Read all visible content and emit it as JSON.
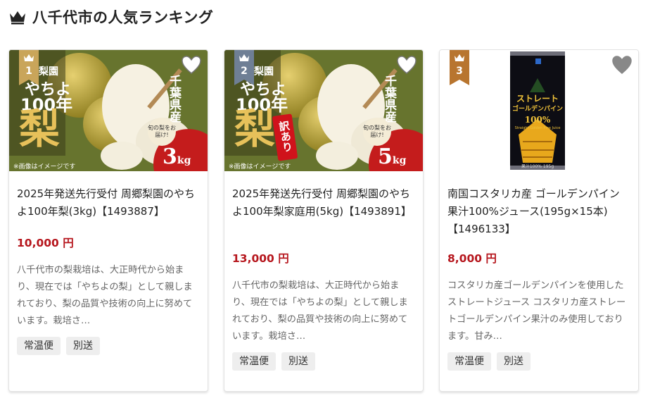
{
  "header": {
    "title": "八千代市の人気ランキング",
    "icon": "crown-icon"
  },
  "cards": [
    {
      "rank": "1",
      "rank_color": "#c9a55a",
      "name": "2025年発送先行受付 周郷梨園のやちよ100年梨(3kg)【1493887】",
      "price": "10,000 円",
      "desc": "八千代市の梨栽培は、大正時代から始まり、現在では「やちよの梨」として親しまれており、梨の品質や技術の向上に努めています。栽培さ…",
      "tags": [
        "常温便",
        "別送"
      ],
      "img": {
        "brand": "梨園",
        "yachiyo": "やちよ",
        "hundred": "100年",
        "nashi": "梨",
        "pref": "千葉県産",
        "kg": "3",
        "kg_unit": "kg",
        "note": "※画像はイメージです",
        "seal": "旬の梨をお届け!",
        "wake": ""
      }
    },
    {
      "rank": "2",
      "rank_color": "#6f7f95",
      "name": "2025年発送先行受付 周郷梨園のやちよ100年梨家庭用(5kg)【1493891】",
      "price": "13,000 円",
      "desc": "八千代市の梨栽培は、大正時代から始まり、現在では「やちよの梨」として親しまれており、梨の品質や技術の向上に努めています。栽培さ…",
      "tags": [
        "常温便",
        "別送"
      ],
      "img": {
        "brand": "梨園",
        "yachiyo": "やちよ",
        "hundred": "100年",
        "nashi": "梨",
        "pref": "千葉県産",
        "kg": "5",
        "kg_unit": "kg",
        "note": "※画像はイメージです",
        "seal": "旬の梨をお届け!",
        "wake": "訳あり"
      }
    },
    {
      "rank": "3",
      "rank_color": "#b8752f",
      "name": "南国コスタリカ産 ゴールデンパイン 果汁100%ジュース(195g×15本)【1496133】",
      "price": "8,000 円",
      "desc": "コスタリカ産ゴールデンパインを使用したストレートジュース コスタリカ産ストレートゴールデンパイン果汁のみ使用しております。甘み…",
      "tags": [
        "常温便",
        "別送"
      ],
      "img": {
        "line1": "ストレート",
        "line2": "ゴールデンパイン",
        "pct": "100%",
        "sub": "Straight Golden Pine Juice",
        "juice": "果汁100% 195g"
      }
    }
  ]
}
